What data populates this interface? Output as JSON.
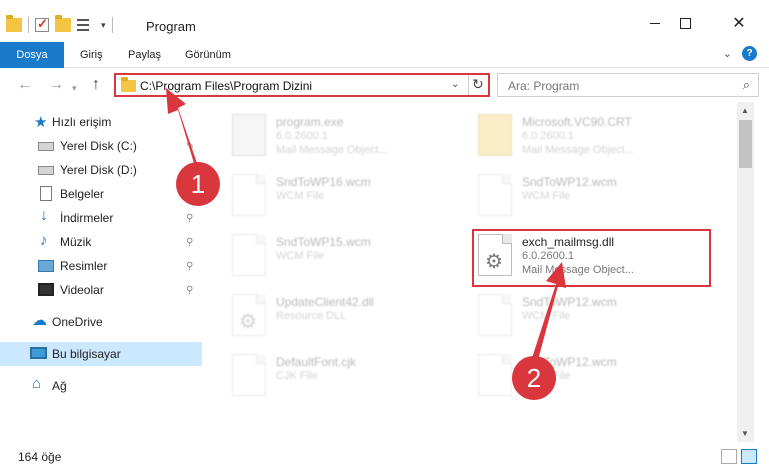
{
  "window": {
    "title": "Program"
  },
  "ribbon": {
    "tabs": [
      {
        "label": "Dosya"
      },
      {
        "label": "Giriş"
      },
      {
        "label": "Paylaş"
      },
      {
        "label": "Görünüm"
      }
    ]
  },
  "address": {
    "path": "C:\\Program Files\\Program Dizini"
  },
  "search": {
    "placeholder": "Ara: Program"
  },
  "sidebar": {
    "items": [
      {
        "label": "Hızlı erişim",
        "icon": "star-icon"
      },
      {
        "label": "Yerel Disk (C:)",
        "icon": "drive-icon"
      },
      {
        "label": "Yerel Disk (D:)",
        "icon": "drive-icon"
      },
      {
        "label": "Belgeler",
        "icon": "documents-icon"
      },
      {
        "label": "İndirmeler",
        "icon": "downloads-icon"
      },
      {
        "label": "Müzik",
        "icon": "music-icon"
      },
      {
        "label": "Resimler",
        "icon": "pictures-icon"
      },
      {
        "label": "Videolar",
        "icon": "videos-icon"
      },
      {
        "label": "OneDrive",
        "icon": "cloud-icon"
      },
      {
        "label": "Bu bilgisayar",
        "icon": "computer-icon"
      },
      {
        "label": "Ağ",
        "icon": "network-icon"
      }
    ]
  },
  "files": [
    {
      "name": "program.exe",
      "line1": "6.0.2600.1",
      "line2": "Mail Message Object..."
    },
    {
      "name": "Microsoft.VC90.CRT",
      "line1": "6.0.2600.1",
      "line2": "Mail Message Object..."
    },
    {
      "name": "SndToWP16.wcm",
      "line1": "WCM File",
      "line2": ""
    },
    {
      "name": "SndToWP12.wcm",
      "line1": "WCM File",
      "line2": ""
    },
    {
      "name": "SndToWP15.wcm",
      "line1": "WCM File",
      "line2": ""
    },
    {
      "name": "exch_mailmsg.dll",
      "line1": "6.0.2600.1",
      "line2": "Mail Message Object..."
    },
    {
      "name": "UpdateClient42.dll",
      "line1": "Resource DLL",
      "line2": ""
    },
    {
      "name": "SndToWP12.wcm",
      "line1": "WCM File",
      "line2": ""
    },
    {
      "name": "DefaultFont.cjk",
      "line1": "CJK File",
      "line2": ""
    },
    {
      "name": "SndToWP12.wcm",
      "line1": "WCM File",
      "line2": ""
    }
  ],
  "status": {
    "count": "164 öğe"
  },
  "annotations": {
    "badge1": "1",
    "badge2": "2",
    "color": "#d9363e"
  }
}
